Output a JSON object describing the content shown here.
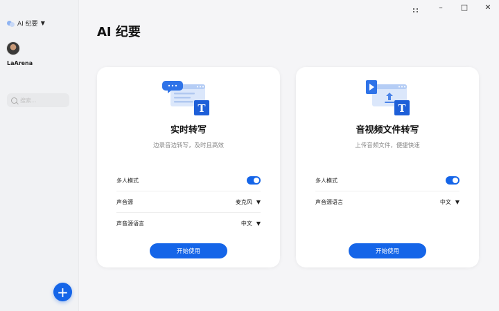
{
  "sidebar": {
    "app_name": "AI 纪要",
    "username": "LaArena",
    "search_placeholder": "搜索..."
  },
  "page": {
    "title": "AI 纪要"
  },
  "cards": [
    {
      "title": "实时转写",
      "subtitle": "边录音边转写，及时且高效",
      "options": {
        "multi_mode": "多人模式",
        "audio_source": "声音源",
        "audio_source_value": "麦克风",
        "language": "声音源语言",
        "language_value": "中文"
      },
      "button": "开始使用"
    },
    {
      "title": "音视频文件转写",
      "subtitle": "上传音频文件，便捷快速",
      "options": {
        "multi_mode": "多人模式",
        "language": "声音源语言",
        "language_value": "中文"
      },
      "button": "开始使用"
    }
  ],
  "colors": {
    "accent": "#1565e8",
    "background": "#f5f5f7",
    "card": "#ffffff"
  },
  "icons": [
    "cloud-logo-icon",
    "chevron-down-icon",
    "search-icon",
    "plus-icon",
    "grid-icon",
    "minimize-icon",
    "maximize-icon",
    "close-icon",
    "chat-transcript-icon",
    "video-upload-icon"
  ]
}
